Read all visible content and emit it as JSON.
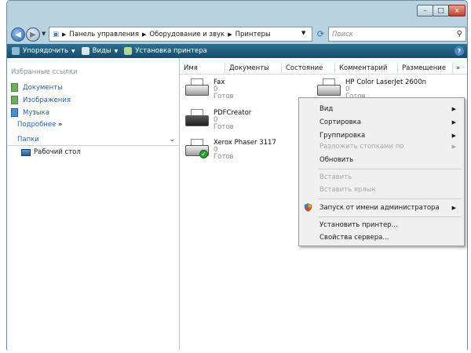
{
  "window": {
    "minimize": "–",
    "maximize": "□",
    "close": "x"
  },
  "address": {
    "crumbs": [
      "Панель управления",
      "Оборудование и звук",
      "Принтеры"
    ],
    "search_placeholder": "Поиск"
  },
  "commandbar": {
    "organize": "Упорядочить",
    "views": "Виды",
    "add_printer": "Установка принтера"
  },
  "sidebar": {
    "favorites_title": "Избранные ссылки",
    "items": [
      {
        "label": "Документы"
      },
      {
        "label": "Изображения"
      },
      {
        "label": "Музыка"
      }
    ],
    "more": "Подробнее",
    "folders": "Папки",
    "desktop": "Рабочий стол"
  },
  "columns": [
    "Имя",
    "Документы",
    "Состояние",
    "Комментарий",
    "Размещение"
  ],
  "printers": [
    {
      "name": "Fax",
      "docs": "0",
      "status": "Готов"
    },
    {
      "name": "PDFCreator",
      "docs": "0",
      "status": "Готов"
    },
    {
      "name": "Xerox Phaser 3117",
      "docs": "0",
      "status": "Готов"
    },
    {
      "name": "HP Color LaserJet 2600n",
      "docs": "0",
      "status": "Готов"
    }
  ],
  "context_menu": {
    "view": "Вид",
    "sort": "Сортировка",
    "group": "Группировка",
    "stack": "Разложить стопками по",
    "refresh": "Обновить",
    "paste": "Вставить",
    "paste_shortcut": "Вставить ярлык",
    "run_as_admin": "Запуск от имени администратора",
    "install_printer": "Установить принтер...",
    "server_props": "Свойства сервера..."
  },
  "colors": {
    "accent": "#1d5a7a",
    "link": "#2b5fa8"
  }
}
